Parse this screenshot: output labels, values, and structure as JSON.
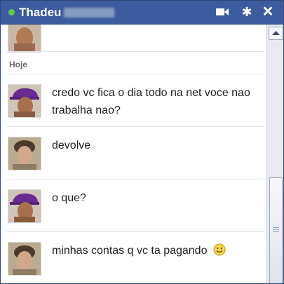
{
  "window": {
    "contact_name": "Thadeu",
    "status_color": "#63c94c",
    "title_bar_color": "#3b5c9e",
    "icons": [
      "video-call-icon",
      "gear-icon",
      "close-icon"
    ]
  },
  "chat": {
    "previous_message_fragment": "",
    "day_label": "Hoje",
    "messages": [
      {
        "sender": "purple-cap-user",
        "text": "credo vc fica o dia todo na net voce nao trabalha nao?"
      },
      {
        "sender": "thadeu",
        "text": "devolve"
      },
      {
        "sender": "purple-cap-user",
        "text": "o que?"
      },
      {
        "sender": "thadeu",
        "text": "minhas contas q vc ta pagando",
        "emoji": "smiley-icon"
      }
    ]
  }
}
